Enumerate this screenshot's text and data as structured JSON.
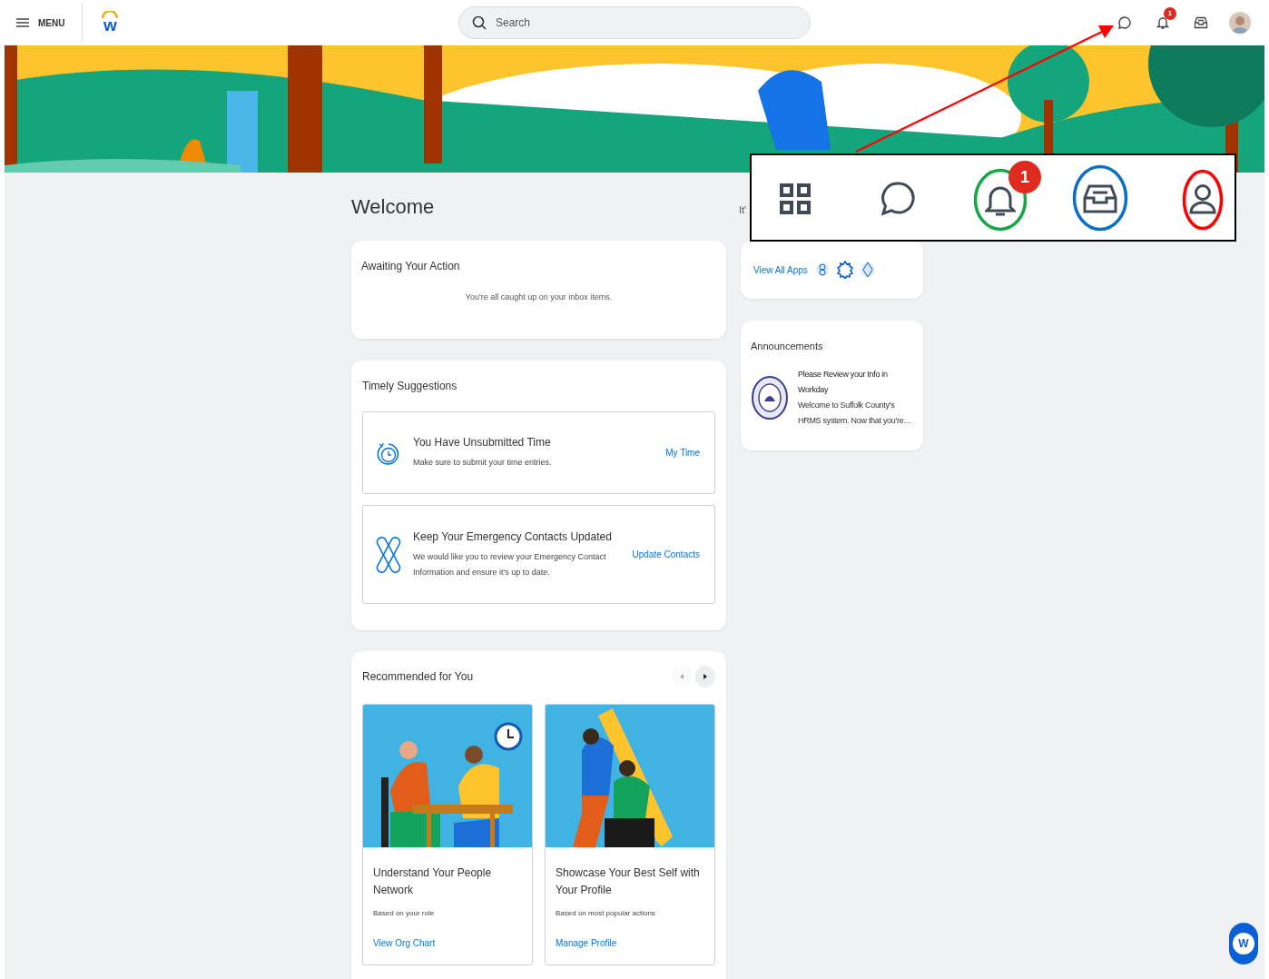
{
  "header": {
    "menu_label": "MENU",
    "logo": "w",
    "search": {
      "placeholder": "Search"
    },
    "notification_count": "1"
  },
  "welcome": {
    "title": "Welcome",
    "greeting_fragment": "It'"
  },
  "awaiting": {
    "title": "Awaiting Your Action",
    "message": "You're all caught up on your inbox items."
  },
  "timely": {
    "title": "Timely Suggestions",
    "items": [
      {
        "kind": "time",
        "title": "You Have Unsubmitted Time",
        "text": "Make sure to submit your time entries.",
        "link": "My Time"
      },
      {
        "kind": "contacts",
        "title": "Keep Your Emergency Contacts Updated",
        "text": "We would like you to review your Emergency Contact Information and ensure it's up to date.",
        "link": "Update Contacts"
      }
    ]
  },
  "recommended": {
    "title": "Recommended for You",
    "carousel": [
      {
        "kind": "prev",
        "disabled": true
      },
      {
        "kind": "next",
        "disabled": false
      }
    ],
    "cards": [
      {
        "kind": "meeting",
        "title": "Understand Your People Network",
        "note": "Based on your role",
        "link": "View Org Chart"
      },
      {
        "kind": "pencil",
        "title": "Showcase Your Best Self with Your Profile",
        "note": "Based on most popular actions",
        "link": "Manage Profile"
      }
    ]
  },
  "apps": {
    "link": "View All Apps"
  },
  "announcements": {
    "title": "Announcements",
    "items": [
      {
        "title": "Please Review your Info in Workday",
        "text": "Welcome to Suffolk County's HRMS system. Now that you're…"
      }
    ]
  },
  "callout": {
    "badge": "1"
  },
  "assistant": {
    "logo": "W"
  }
}
